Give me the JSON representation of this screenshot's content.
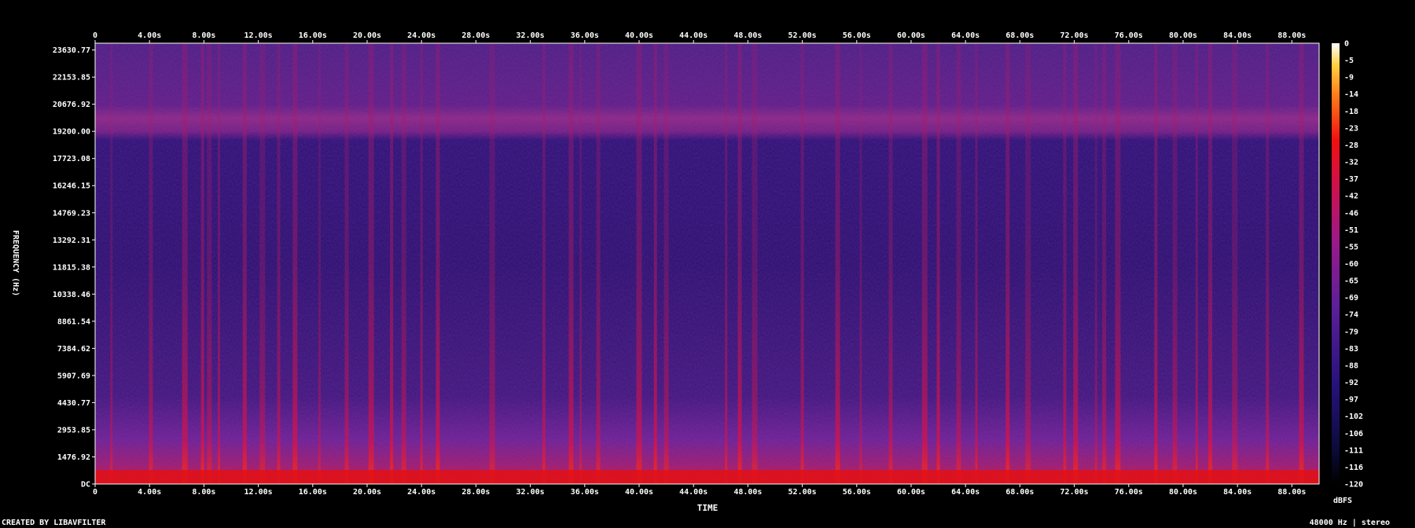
{
  "chart_data": {
    "type": "heatmap",
    "title": "",
    "xlabel": "TIME",
    "ylabel": "FREQUENCY (Hz)",
    "x_ticks": [
      "0",
      "4.00s",
      "8.00s",
      "12.00s",
      "16.00s",
      "20.00s",
      "24.00s",
      "28.00s",
      "32.00s",
      "36.00s",
      "40.00s",
      "44.00s",
      "48.00s",
      "52.00s",
      "56.00s",
      "60.00s",
      "64.00s",
      "68.00s",
      "72.00s",
      "76.00s",
      "80.00s",
      "84.00s",
      "88.00s"
    ],
    "x_tick_values": [
      0,
      4,
      8,
      12,
      16,
      20,
      24,
      28,
      32,
      36,
      40,
      44,
      48,
      52,
      56,
      60,
      64,
      68,
      72,
      76,
      80,
      84,
      88
    ],
    "xlim": [
      0,
      90
    ],
    "y_ticks": [
      "DC",
      "1476.92",
      "2953.85",
      "4430.77",
      "5907.69",
      "7384.62",
      "8861.54",
      "10338.46",
      "11815.38",
      "13292.31",
      "14769.23",
      "16246.15",
      "17723.08",
      "19200.00",
      "20676.92",
      "22153.85",
      "23630.77"
    ],
    "y_tick_values": [
      0,
      1476.92,
      2953.85,
      4430.77,
      5907.69,
      7384.62,
      8861.54,
      10338.46,
      11815.38,
      13292.31,
      14769.23,
      16246.15,
      17723.08,
      19200.0,
      20676.92,
      22153.85,
      23630.77
    ],
    "ylim": [
      0,
      24000
    ],
    "colorbar": {
      "label": "dBFS",
      "ticks": [
        "0",
        "-5",
        "-9",
        "-14",
        "-18",
        "-23",
        "-28",
        "-32",
        "-37",
        "-42",
        "-46",
        "-51",
        "-55",
        "-60",
        "-65",
        "-69",
        "-74",
        "-79",
        "-83",
        "-88",
        "-92",
        "-97",
        "-102",
        "-106",
        "-111",
        "-116",
        "-120"
      ],
      "range": [
        -120,
        0
      ]
    },
    "footer_left": "CREATED BY LIBAVFILTER",
    "footer_right": "48000 Hz | stereo",
    "onset_times": [
      1.2,
      4.1,
      6.6,
      7.9,
      8.4,
      9.1,
      11.0,
      12.3,
      13.5,
      14.7,
      16.5,
      18.5,
      20.3,
      21.8,
      22.7,
      24.0,
      25.2,
      29.2,
      33.0,
      35.0,
      35.7,
      37.0,
      40.0,
      41.2,
      42.0,
      46.4,
      47.4,
      48.5,
      52.0,
      54.6,
      56.3,
      58.5,
      61.0,
      62.0,
      63.5,
      64.8,
      67.1,
      68.6,
      71.3,
      72.1,
      73.6,
      74.2,
      75.2,
      78.0,
      79.4,
      81.0,
      82.0,
      83.8,
      86.2,
      88.7
    ],
    "colors": {
      "background": "#000000",
      "low": "#1a0a6e",
      "mid": "#7a1f9a",
      "high": "#e0101a",
      "peak": "#fff6b0"
    }
  }
}
